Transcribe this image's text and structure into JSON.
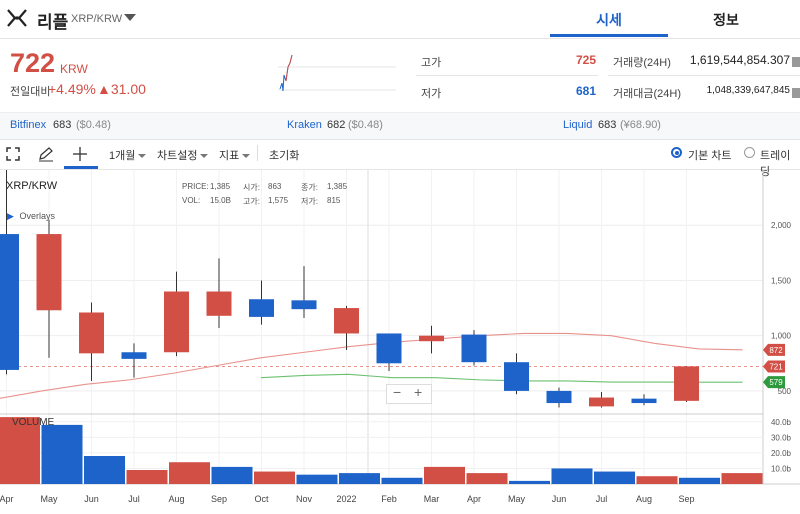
{
  "header": {
    "coin_name": "리플",
    "coin_pair": "XRP/KRW",
    "tabs": [
      {
        "label": "시세",
        "active": true
      },
      {
        "label": "정보",
        "active": false
      }
    ]
  },
  "ticker": {
    "price": "722",
    "unit": "KRW",
    "change_label": "전일대비",
    "change_rate": "+4.49%",
    "change_amount": "▲31.00",
    "high_label": "고가",
    "high_value": "725",
    "low_label": "저가",
    "low_value": "681",
    "volume_label": "거래량(24H)",
    "volume_value": "1,619,544,854.307",
    "trade_value_label": "거래대금(24H)",
    "trade_value": "1,048,339,647,845",
    "up_color": "#d24f45",
    "down_color": "#1d63c9"
  },
  "exchanges": [
    {
      "name": "Bitfinex",
      "price": "683",
      "sub": "($0.48)"
    },
    {
      "name": "Kraken",
      "price": "682",
      "sub": "($0.48)"
    },
    {
      "name": "Liquid",
      "price": "683",
      "sub": "(¥68.90)"
    }
  ],
  "toolbar": {
    "period": "1개월",
    "chart_settings": "차트설정",
    "indicators": "지표",
    "reset": "초기화",
    "chart_basic": "기본 차트",
    "chart_tv": "트레이딩"
  },
  "chart_panel": {
    "symbol": "XRP/KRW",
    "overlays": "Overlays",
    "price_label": "PRICE:",
    "price_val": "1,385",
    "open_label": "시가:",
    "open_val": "863",
    "close_label": "종가:",
    "close_val": "1,385",
    "vol_label": "VOL:",
    "vol_val": "15.0B",
    "high_label": "고가:",
    "high_val": "1,575",
    "low_label": "저가:",
    "low_val": "815",
    "volume_title": "VOLUME",
    "zoom_minus": "−",
    "zoom_plus": "+"
  },
  "chart_data": {
    "type": "candlestick",
    "title": "",
    "x_labels": [
      "Apr",
      "May",
      "Jun",
      "Jul",
      "Aug",
      "Sep",
      "Oct",
      "Nov",
      "2022",
      "Feb",
      "Mar",
      "Apr",
      "May",
      "Jun",
      "Jul",
      "Aug",
      "Sep"
    ],
    "candles": [
      {
        "open": 1920,
        "close": 690,
        "high": 2500,
        "low": 650
      },
      {
        "open": 1230,
        "close": 1920,
        "high": 2050,
        "low": 800
      },
      {
        "open": 840,
        "close": 1210,
        "high": 1300,
        "low": 590
      },
      {
        "open": 850,
        "close": 790,
        "high": 930,
        "low": 620
      },
      {
        "open": 850,
        "close": 1400,
        "high": 1580,
        "low": 815
      },
      {
        "open": 1180,
        "close": 1400,
        "high": 1700,
        "low": 1070
      },
      {
        "open": 1330,
        "close": 1170,
        "high": 1500,
        "low": 1100
      },
      {
        "open": 1320,
        "close": 1240,
        "high": 1630,
        "low": 1160
      },
      {
        "open": 1020,
        "close": 1250,
        "high": 1270,
        "low": 870
      },
      {
        "open": 1020,
        "close": 750,
        "high": 1020,
        "low": 680
      },
      {
        "open": 950,
        "close": 1000,
        "high": 1090,
        "low": 840
      },
      {
        "open": 1010,
        "close": 760,
        "high": 1050,
        "low": 730
      },
      {
        "open": 760,
        "close": 500,
        "high": 840,
        "low": 470
      },
      {
        "open": 500,
        "close": 390,
        "high": 530,
        "low": 350
      },
      {
        "open": 360,
        "close": 440,
        "high": 490,
        "low": 350
      },
      {
        "open": 430,
        "close": 390,
        "high": 470,
        "low": 370
      },
      {
        "open": 410,
        "close": 722,
        "high": 725,
        "low": 400
      }
    ],
    "volumes": [
      43,
      38,
      18,
      9,
      14,
      11,
      8,
      6,
      7,
      4,
      11,
      7,
      2,
      10,
      8,
      5,
      4,
      7
    ],
    "volume_colors": [
      "up",
      "down",
      "down",
      "up",
      "up",
      "down",
      "up",
      "down",
      "down",
      "down",
      "up",
      "up",
      "down",
      "down",
      "down",
      "up",
      "down",
      "up"
    ],
    "volume_count": 18,
    "ma_red": [
      430,
      500,
      560,
      600,
      660,
      730,
      800,
      850,
      900,
      940,
      970,
      1000,
      1020,
      1020,
      1000,
      930,
      880,
      872
    ],
    "ma_green": [
      null,
      null,
      null,
      null,
      null,
      null,
      620,
      640,
      650,
      620,
      620,
      600,
      590,
      590,
      580,
      580,
      579,
      579
    ],
    "y_ticks": [
      500,
      1000,
      1500,
      2000
    ],
    "y_tick_labels": [
      "500",
      "1,000",
      "1,500",
      "2,000"
    ],
    "price_tags": [
      {
        "label": "872",
        "value": 872,
        "color": "#d24f45"
      },
      {
        "label": "721",
        "value": 721,
        "color": "#d24f45"
      },
      {
        "label": "579",
        "value": 579,
        "color": "#2e9a3e"
      }
    ],
    "vol_ticks": [
      10,
      20,
      30,
      40
    ],
    "vol_tick_labels": [
      "10.0b",
      "20.0b",
      "30.0b",
      "40.0b"
    ],
    "ylim": [
      300,
      2500
    ],
    "vol_ylim": [
      0,
      45
    ]
  }
}
